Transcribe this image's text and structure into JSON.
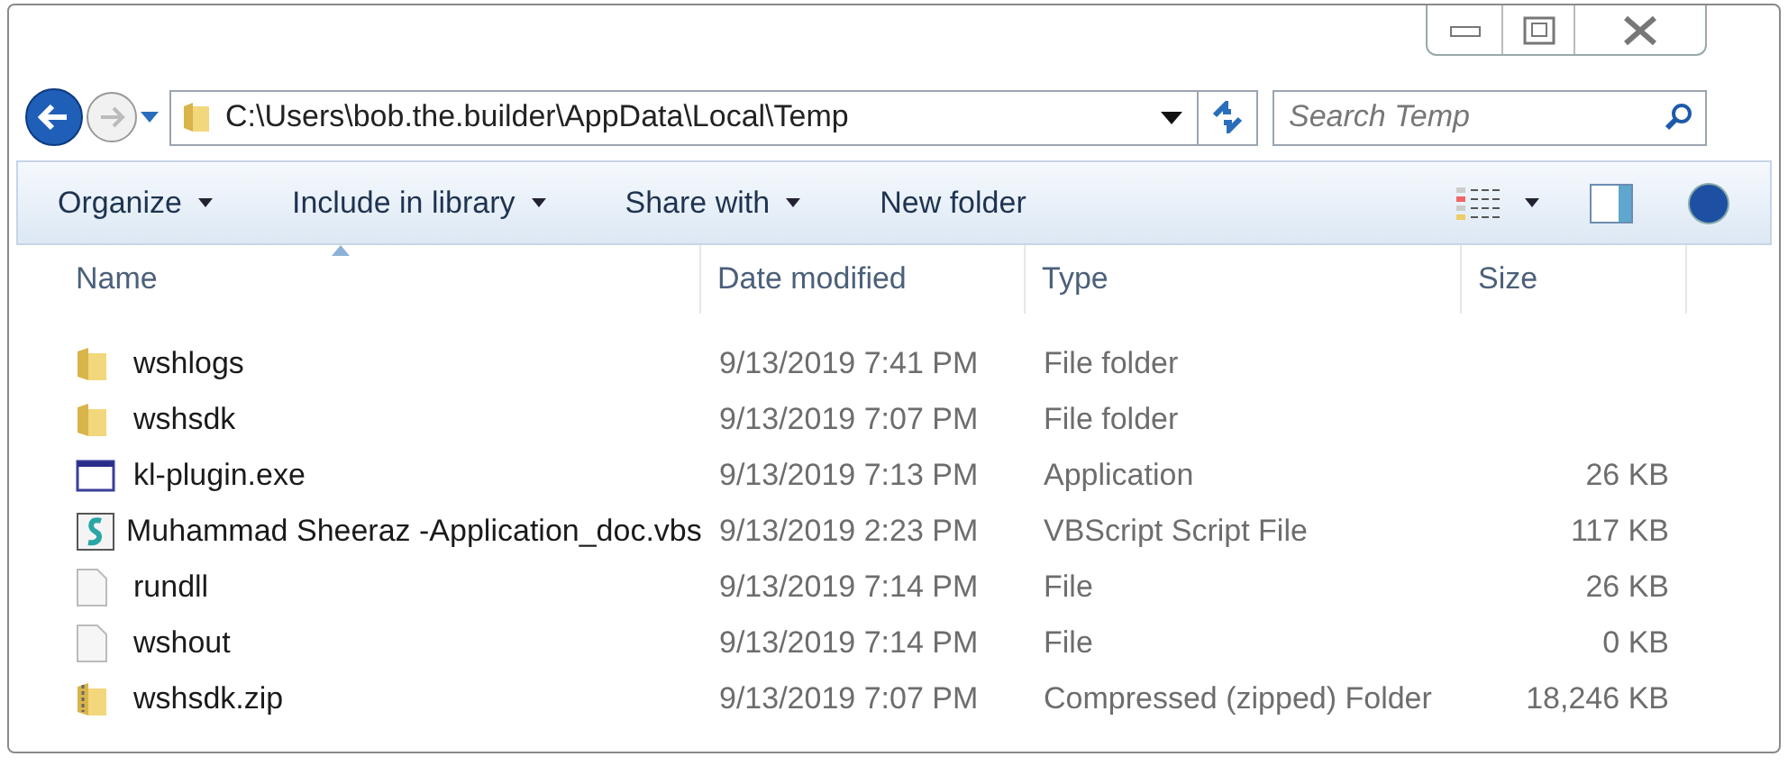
{
  "address_bar": {
    "path": "C:\\Users\\bob.the.builder\\AppData\\Local\\Temp"
  },
  "search": {
    "placeholder": "Search Temp"
  },
  "toolbar": {
    "items": [
      {
        "label": "Organize",
        "has_menu": true
      },
      {
        "label": "Include in library",
        "has_menu": true
      },
      {
        "label": "Share with",
        "has_menu": true
      },
      {
        "label": "New folder",
        "has_menu": false
      }
    ]
  },
  "table": {
    "columns": [
      {
        "label": "Name",
        "sorted": true
      },
      {
        "label": "Date modified",
        "sorted": false
      },
      {
        "label": "Type",
        "sorted": false
      },
      {
        "label": "Size",
        "sorted": false
      }
    ],
    "rows": [
      {
        "kind": "folder",
        "name": "wshlogs",
        "date": "9/13/2019 7:41 PM",
        "type": "File folder",
        "size": ""
      },
      {
        "kind": "folder",
        "name": "wshsdk",
        "date": "9/13/2019 7:07 PM",
        "type": "File folder",
        "size": ""
      },
      {
        "kind": "exe",
        "name": "kl-plugin.exe",
        "date": "9/13/2019 7:13 PM",
        "type": "Application",
        "size": "26 KB"
      },
      {
        "kind": "script",
        "name": "Muhammad Sheeraz -Application_doc.vbs",
        "date": "9/13/2019 2:23 PM",
        "type": "VBScript Script File",
        "size": "117 KB"
      },
      {
        "kind": "file",
        "name": "rundll",
        "date": "9/13/2019 7:14 PM",
        "type": "File",
        "size": "26 KB"
      },
      {
        "kind": "file",
        "name": "wshout",
        "date": "9/13/2019 7:14 PM",
        "type": "File",
        "size": "0 KB"
      },
      {
        "kind": "zip",
        "name": "wshsdk.zip",
        "date": "9/13/2019 7:07 PM",
        "type": "Compressed (zipped) Folder",
        "size": "18,246 KB"
      }
    ]
  }
}
